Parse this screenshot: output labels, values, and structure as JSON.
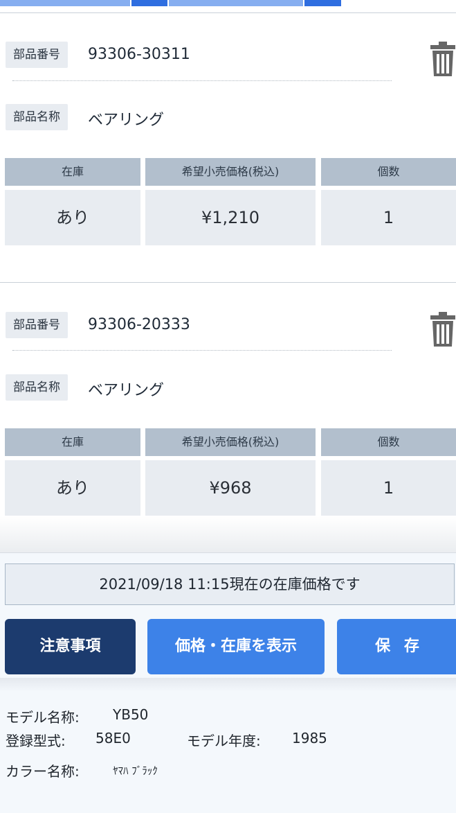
{
  "parts": [
    {
      "part_number_label": "部品番号",
      "part_number": "93306-30311",
      "part_name_label": "部品名称",
      "part_name": "ベアリング",
      "headers": [
        "在庫",
        "希望小売価格(税込)",
        "個数"
      ],
      "stock": "あり",
      "price": "¥1,210",
      "quantity": "1"
    },
    {
      "part_number_label": "部品番号",
      "part_number": "93306-20333",
      "part_name_label": "部品名称",
      "part_name": "ベアリング",
      "headers": [
        "在庫",
        "希望小売価格(税込)",
        "個数"
      ],
      "stock": "あり",
      "price": "¥968",
      "quantity": "1"
    }
  ],
  "status": {
    "stock_time": "2021/09/18 11:15現在の在庫価格です"
  },
  "buttons": {
    "notice": "注意事項",
    "show_price": "価格・在庫を表示",
    "save": "保 存"
  },
  "model_info": {
    "model_name_label": "モデル名称:",
    "model_name": "YB50",
    "type_label": "登録型式:",
    "type": "58E0",
    "year_label": "モデル年度:",
    "year": "1985",
    "color_label": "カラー名称:",
    "color": "ﾔﾏﾊ ﾌﾞﾗｯｸ"
  },
  "icons": {
    "delete": "trash-icon"
  },
  "colors": {
    "header_bg": "#b2bfcd",
    "cell_bg": "#e8ecf1",
    "notice_button": "#1c3b6e",
    "primary_button": "#3d82e8"
  }
}
